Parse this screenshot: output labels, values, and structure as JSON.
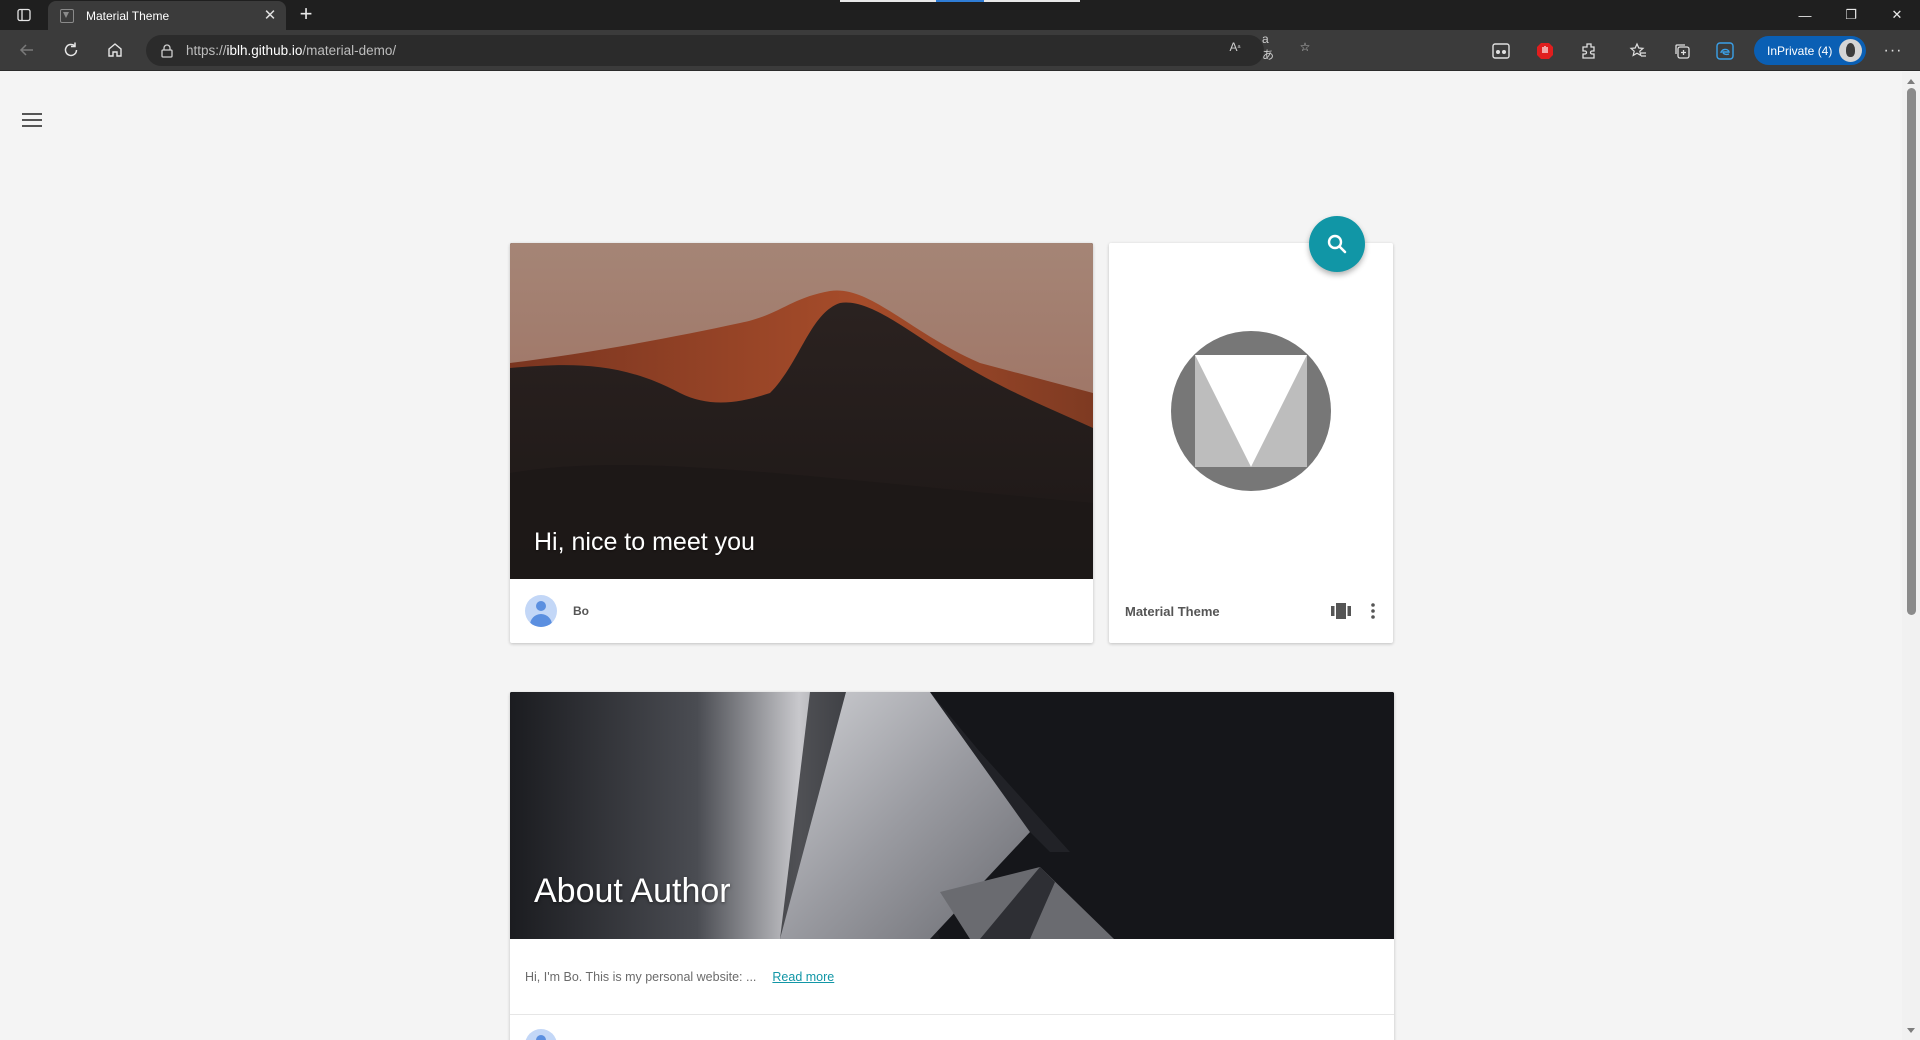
{
  "browser": {
    "tab_title": "Material Theme",
    "tab_close": "✕",
    "new_tab": "+",
    "url_prefix": "https://",
    "url_host": "iblh.github.io",
    "url_path": "/material-demo/",
    "inprivate_label": "InPrivate (4)",
    "window_controls": {
      "minimize": "—",
      "restore": "❐",
      "close": "✕"
    }
  },
  "page": {
    "hero": {
      "heading": "Hi, nice to meet you",
      "author": "Bo"
    },
    "logo_card": {
      "title": "Material Theme"
    },
    "about": {
      "heading": "About Author",
      "excerpt": "Hi, I'm Bo. This is my personal website: ...",
      "read_more": "Read more"
    }
  },
  "colors": {
    "accent": "#1196a6",
    "browser_dark": "#1f1f1f",
    "toolbar": "#3b3b3b",
    "inprivate": "#0a5fb4",
    "page_bg": "#f4f4f4"
  },
  "icons": {
    "menu": "hamburger-menu-icon",
    "search": "search-icon",
    "more": "more-vert-icon",
    "theme": "view-carousel-icon"
  }
}
